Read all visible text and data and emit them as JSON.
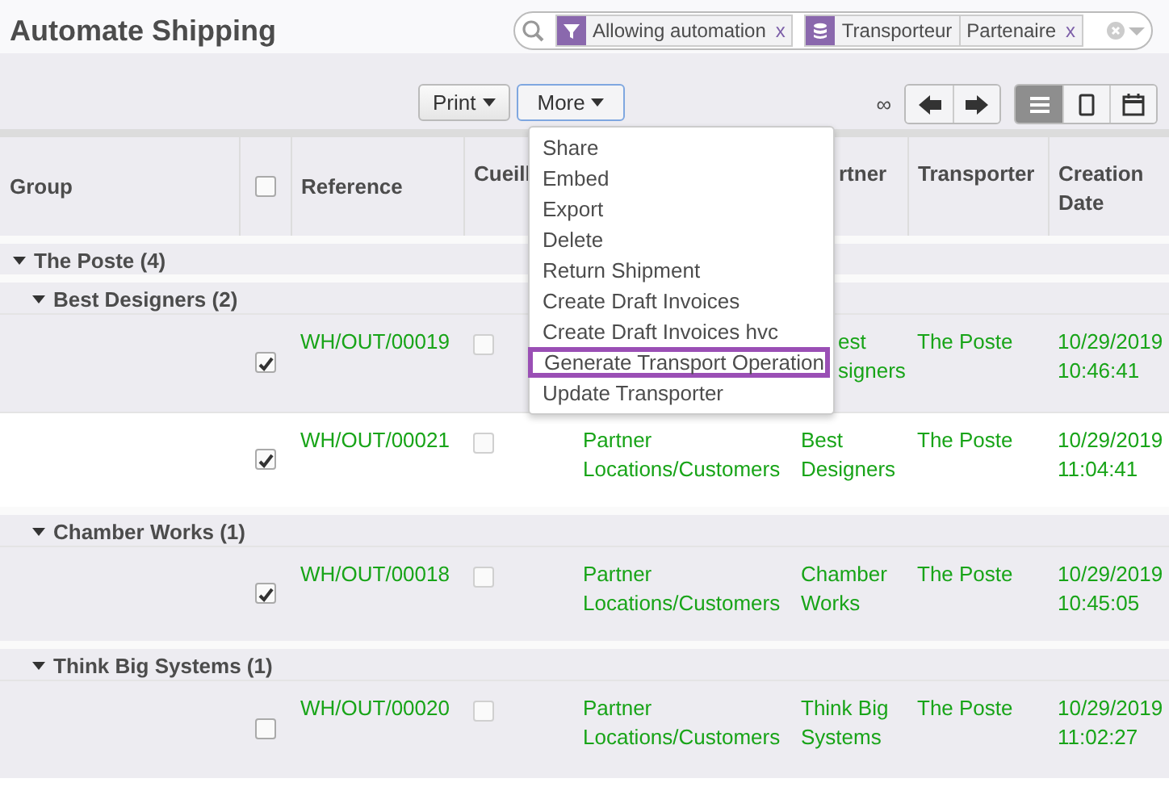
{
  "title": "Automate Shipping",
  "search": {
    "facets": [
      {
        "kind": "filter",
        "values": [
          "Allowing automation"
        ],
        "remove": "x"
      },
      {
        "kind": "groupby",
        "values": [
          "Transporteur",
          "Partenaire"
        ],
        "remove": "x"
      }
    ]
  },
  "toolbar": {
    "buttons": [
      {
        "label": "Print",
        "focused": false
      },
      {
        "label": "More",
        "focused": true
      }
    ],
    "pager": "∞",
    "views": [
      {
        "kind": "list",
        "selected": true
      },
      {
        "kind": "kanban",
        "selected": false
      },
      {
        "kind": "calendar",
        "selected": false
      }
    ]
  },
  "menu": [
    {
      "label": "Share",
      "selected": false
    },
    {
      "label": "Embed",
      "selected": false
    },
    {
      "label": "Export",
      "selected": false
    },
    {
      "label": "Delete",
      "selected": false
    },
    {
      "label": "Return Shipment",
      "selected": false
    },
    {
      "label": "Create Draft Invoices",
      "selected": false
    },
    {
      "label": "Create Draft Invoices hvc",
      "selected": false
    },
    {
      "label": "Generate Transport Operation",
      "selected": true
    },
    {
      "label": "Update Transporter",
      "selected": false
    }
  ],
  "table": {
    "select_all": false,
    "columns": [
      "Group",
      "Reference",
      "Cueill",
      "rtner",
      "Transporter",
      "Creation Date"
    ],
    "groups": [
      {
        "label": "The Poste (4)",
        "expanded": true,
        "children": [
          {
            "label": "Best Designers (2)",
            "expanded": true,
            "records": [
              {
                "checked": true,
                "reference": "WH/OUT/00019",
                "picked": false,
                "partner": "est\nsigners",
                "partial": true,
                "transporter": "The Poste",
                "date": "10/29/2019\n10:46:41"
              },
              {
                "checked": true,
                "reference": "WH/OUT/00021",
                "picked": false,
                "location": "Partner\nLocations/Customers",
                "partner": "Best\nDesigners",
                "partial": false,
                "transporter": "The Poste",
                "date": "10/29/2019\n11:04:41"
              }
            ]
          },
          {
            "label": "Chamber Works (1)",
            "expanded": true,
            "records": [
              {
                "checked": true,
                "reference": "WH/OUT/00018",
                "picked": false,
                "location": "Partner\nLocations/Customers",
                "partner": "Chamber\nWorks",
                "partial": false,
                "transporter": "The Poste",
                "date": "10/29/2019\n10:45:05"
              }
            ]
          },
          {
            "label": "Think Big Systems (1)",
            "expanded": true,
            "records": [
              {
                "checked": false,
                "reference": "WH/OUT/00020",
                "picked": false,
                "location": "Partner\nLocations/Customers",
                "partner": "Think Big\nSystems",
                "partial": false,
                "transporter": "The Poste",
                "date": "10/29/2019\n11:02:27"
              }
            ]
          }
        ]
      }
    ]
  }
}
